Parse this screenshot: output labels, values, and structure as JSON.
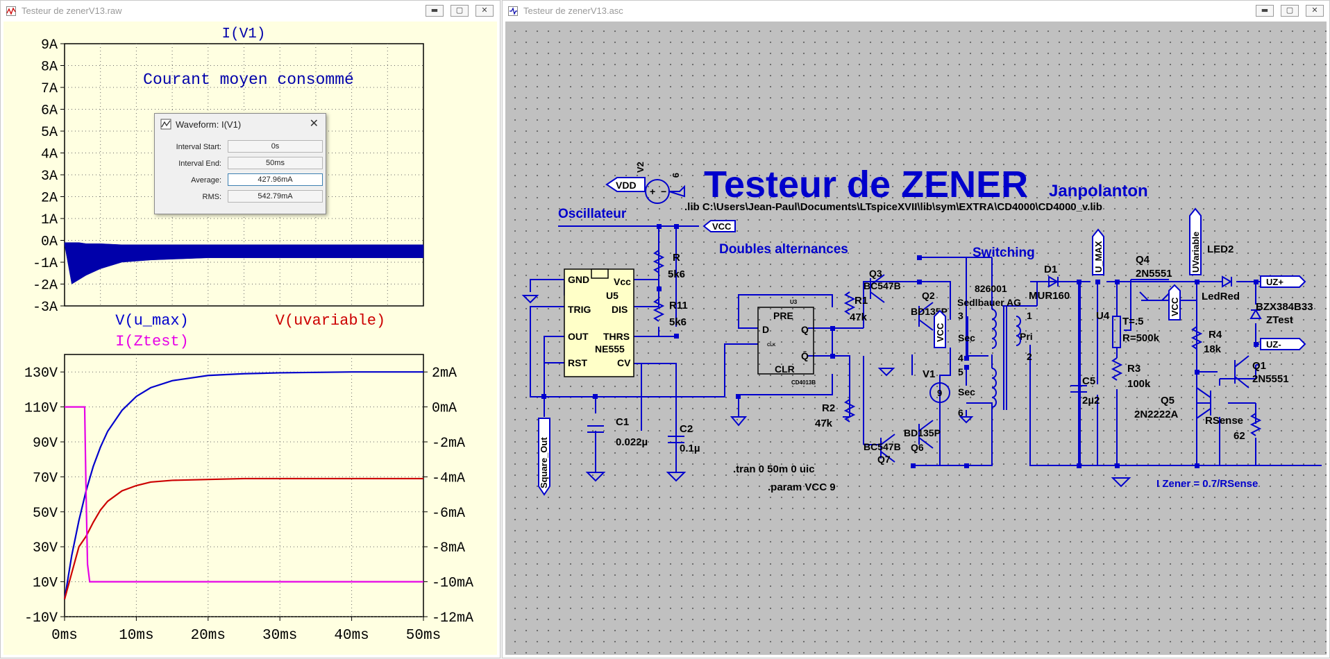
{
  "waveform_window": {
    "title": "Testeur de zenerV13.raw",
    "top_pane": {
      "trace_label": "I(V1)",
      "annotation": "Courant moyen consommé",
      "y_ticks": [
        "9A",
        "8A",
        "7A",
        "6A",
        "5A",
        "4A",
        "3A",
        "2A",
        "1A",
        "0A",
        "-1A",
        "-2A",
        "-3A"
      ]
    },
    "bottom_pane": {
      "trace_labels": [
        "V(u_max)",
        "V(uvariable)",
        "I(Ztest)"
      ],
      "y_left_ticks": [
        "130V",
        "110V",
        "90V",
        "70V",
        "50V",
        "30V",
        "10V",
        "-10V"
      ],
      "y_right_ticks": [
        "2mA",
        "0mA",
        "-2mA",
        "-4mA",
        "-6mA",
        "-8mA",
        "-10mA",
        "-12mA"
      ],
      "x_ticks": [
        "0ms",
        "10ms",
        "20ms",
        "30ms",
        "40ms",
        "50ms"
      ]
    }
  },
  "waveform_dialog": {
    "title": "Waveform: I(V1)",
    "close": "✕",
    "fields": [
      {
        "label": "Interval Start:",
        "value": "0s"
      },
      {
        "label": "Interval End:",
        "value": "50ms"
      },
      {
        "label": "Average:",
        "value": "427.96mA"
      },
      {
        "label": "RMS:",
        "value": "542.79mA"
      }
    ]
  },
  "schematic_window": {
    "title": "Testeur de zenerV13.asc",
    "heading": "Testeur de ZENER",
    "author": "Janpolanton",
    "lib_line": ".lib C:\\Users\\Jean-Paul\\Documents\\LTspiceXVII\\lib\\sym\\EXTRA\\CD4000\\CD4000_v.lib",
    "sections": [
      "Oscillateur",
      "Doubles alternances",
      "Switching"
    ],
    "directives": [
      ".tran 0 50m 0 uic",
      ".param VCC 9",
      "I Zener = 0.7/RSense"
    ],
    "net_labels": [
      "VDD",
      "VCC",
      "VCC",
      "VCC",
      "Square_Out",
      "U_MAX",
      "UVariable",
      "UZ+",
      "UZ-"
    ],
    "ne555": {
      "name": "U5",
      "part": "NE555",
      "pins_left": [
        "GND",
        "TRIG",
        "OUT",
        "RST"
      ],
      "pins_right": [
        "Vcc",
        "DIS",
        "THRS",
        "CV"
      ]
    },
    "cd4013": {
      "name": "U3",
      "part": "CD4013B",
      "pins": [
        "D",
        "CLK",
        "PRE",
        "Q",
        "Q̄",
        "CLR"
      ]
    },
    "components": [
      {
        "ref": "V2",
        "value": "9"
      },
      {
        "ref": "R",
        "value": "5k6"
      },
      {
        "ref": "R11",
        "value": "5k6"
      },
      {
        "ref": "C1",
        "value": "0.022µ"
      },
      {
        "ref": "C2",
        "value": "0.1µ"
      },
      {
        "ref": "R1",
        "value": "47k"
      },
      {
        "ref": "R2",
        "value": "47k"
      },
      {
        "ref": "Q3",
        "value": "BC547B"
      },
      {
        "ref": "Q7",
        "value": "BC547B"
      },
      {
        "ref": "Q2",
        "value": "BD135P"
      },
      {
        "ref": "Q6",
        "value": "BD135P"
      },
      {
        "ref": "V1",
        "value": "9"
      },
      {
        "ref": "D1",
        "value": "MUR160"
      },
      {
        "ref": "C5",
        "value": "2µ2"
      },
      {
        "ref": "U4",
        "value": "T=.5"
      },
      {
        "ref": "U4_R",
        "value": "R=500k"
      },
      {
        "ref": "R3",
        "value": "100k"
      },
      {
        "ref": "Q4",
        "value": "2N5551"
      },
      {
        "ref": "Q1",
        "value": "2N5551"
      },
      {
        "ref": "Q5",
        "value": "2N2222A"
      },
      {
        "ref": "R4",
        "value": "18k"
      },
      {
        "ref": "RSense",
        "value": "62"
      },
      {
        "ref": "LED2",
        "value": "LedRed"
      },
      {
        "ref": "BZX384B33",
        "value": "ZTest"
      }
    ],
    "transformer": {
      "part": "826001",
      "maker": "Sedlbauer AG",
      "sec_pins": [
        "3",
        "4",
        "5",
        "6"
      ],
      "sec_label": "Sec",
      "pri_pins": [
        "1",
        "2"
      ],
      "pri_label": "Pri"
    },
    "colors": {
      "wire": "#0000cc",
      "background": "#c0c0c0",
      "dot": "#6a6a6a",
      "ic_fill": "#ffffc8"
    }
  },
  "plot_colors": {
    "u_max": "#0000cc",
    "uvariable": "#cc0000",
    "ztest": "#e600e6",
    "iv1": "#0000aa",
    "plot_bg": "#ffffe1",
    "grid": "#666666"
  },
  "chart_data": [
    {
      "type": "line",
      "ylabel": "I(V1)",
      "ylim": [
        -3,
        9
      ],
      "xlim": [
        0,
        50
      ],
      "series": [
        {
          "name": "I(V1)",
          "x": [
            0,
            1,
            2,
            3,
            5,
            8,
            12,
            20,
            30,
            40,
            50
          ],
          "y_mid": [
            -0.6,
            -0.8,
            -0.9,
            -0.8,
            -0.6,
            -0.5,
            -0.45,
            -0.45,
            -0.45,
            -0.45,
            -0.45
          ],
          "y_min": [
            -0.2,
            -2.0,
            -1.8,
            -1.6,
            -1.3,
            -1.0,
            -0.9,
            -0.8,
            -0.8,
            -0.8,
            -0.8
          ],
          "y_max": [
            -0.1,
            -0.1,
            -0.1,
            -0.15,
            -0.15,
            -0.2,
            -0.2,
            -0.2,
            -0.2,
            -0.2,
            -0.2
          ]
        }
      ],
      "annotations": [
        "Courant moyen consommé"
      ],
      "grid": true
    },
    {
      "type": "line",
      "ylim": [
        -10,
        140
      ],
      "y2lim": [
        -12,
        3
      ],
      "xlim": [
        0,
        50
      ],
      "series": [
        {
          "name": "V(u_max)",
          "axis": "left",
          "x": [
            0,
            1,
            2,
            3,
            4,
            5,
            6,
            8,
            10,
            12,
            15,
            20,
            25,
            30,
            40,
            50
          ],
          "y": [
            0,
            25,
            45,
            62,
            76,
            87,
            96,
            108,
            116,
            121,
            125,
            128,
            129,
            129.5,
            130,
            130
          ]
        },
        {
          "name": "V(uvariable)",
          "axis": "left",
          "x": [
            0,
            1,
            2,
            3,
            4,
            5,
            6,
            8,
            10,
            12,
            15,
            20,
            25,
            30,
            40,
            50
          ],
          "y": [
            0,
            15,
            30,
            36,
            44,
            51,
            56,
            62,
            65,
            67,
            68,
            68.5,
            69,
            69,
            69,
            69
          ]
        },
        {
          "name": "I(Ztest)",
          "axis": "right",
          "x": [
            0,
            2.8,
            3.0,
            3.2,
            3.5,
            4,
            50
          ],
          "y": [
            0,
            0,
            -5,
            -9,
            -10,
            -10,
            -10
          ]
        }
      ],
      "xlabel": "",
      "grid": true
    }
  ]
}
